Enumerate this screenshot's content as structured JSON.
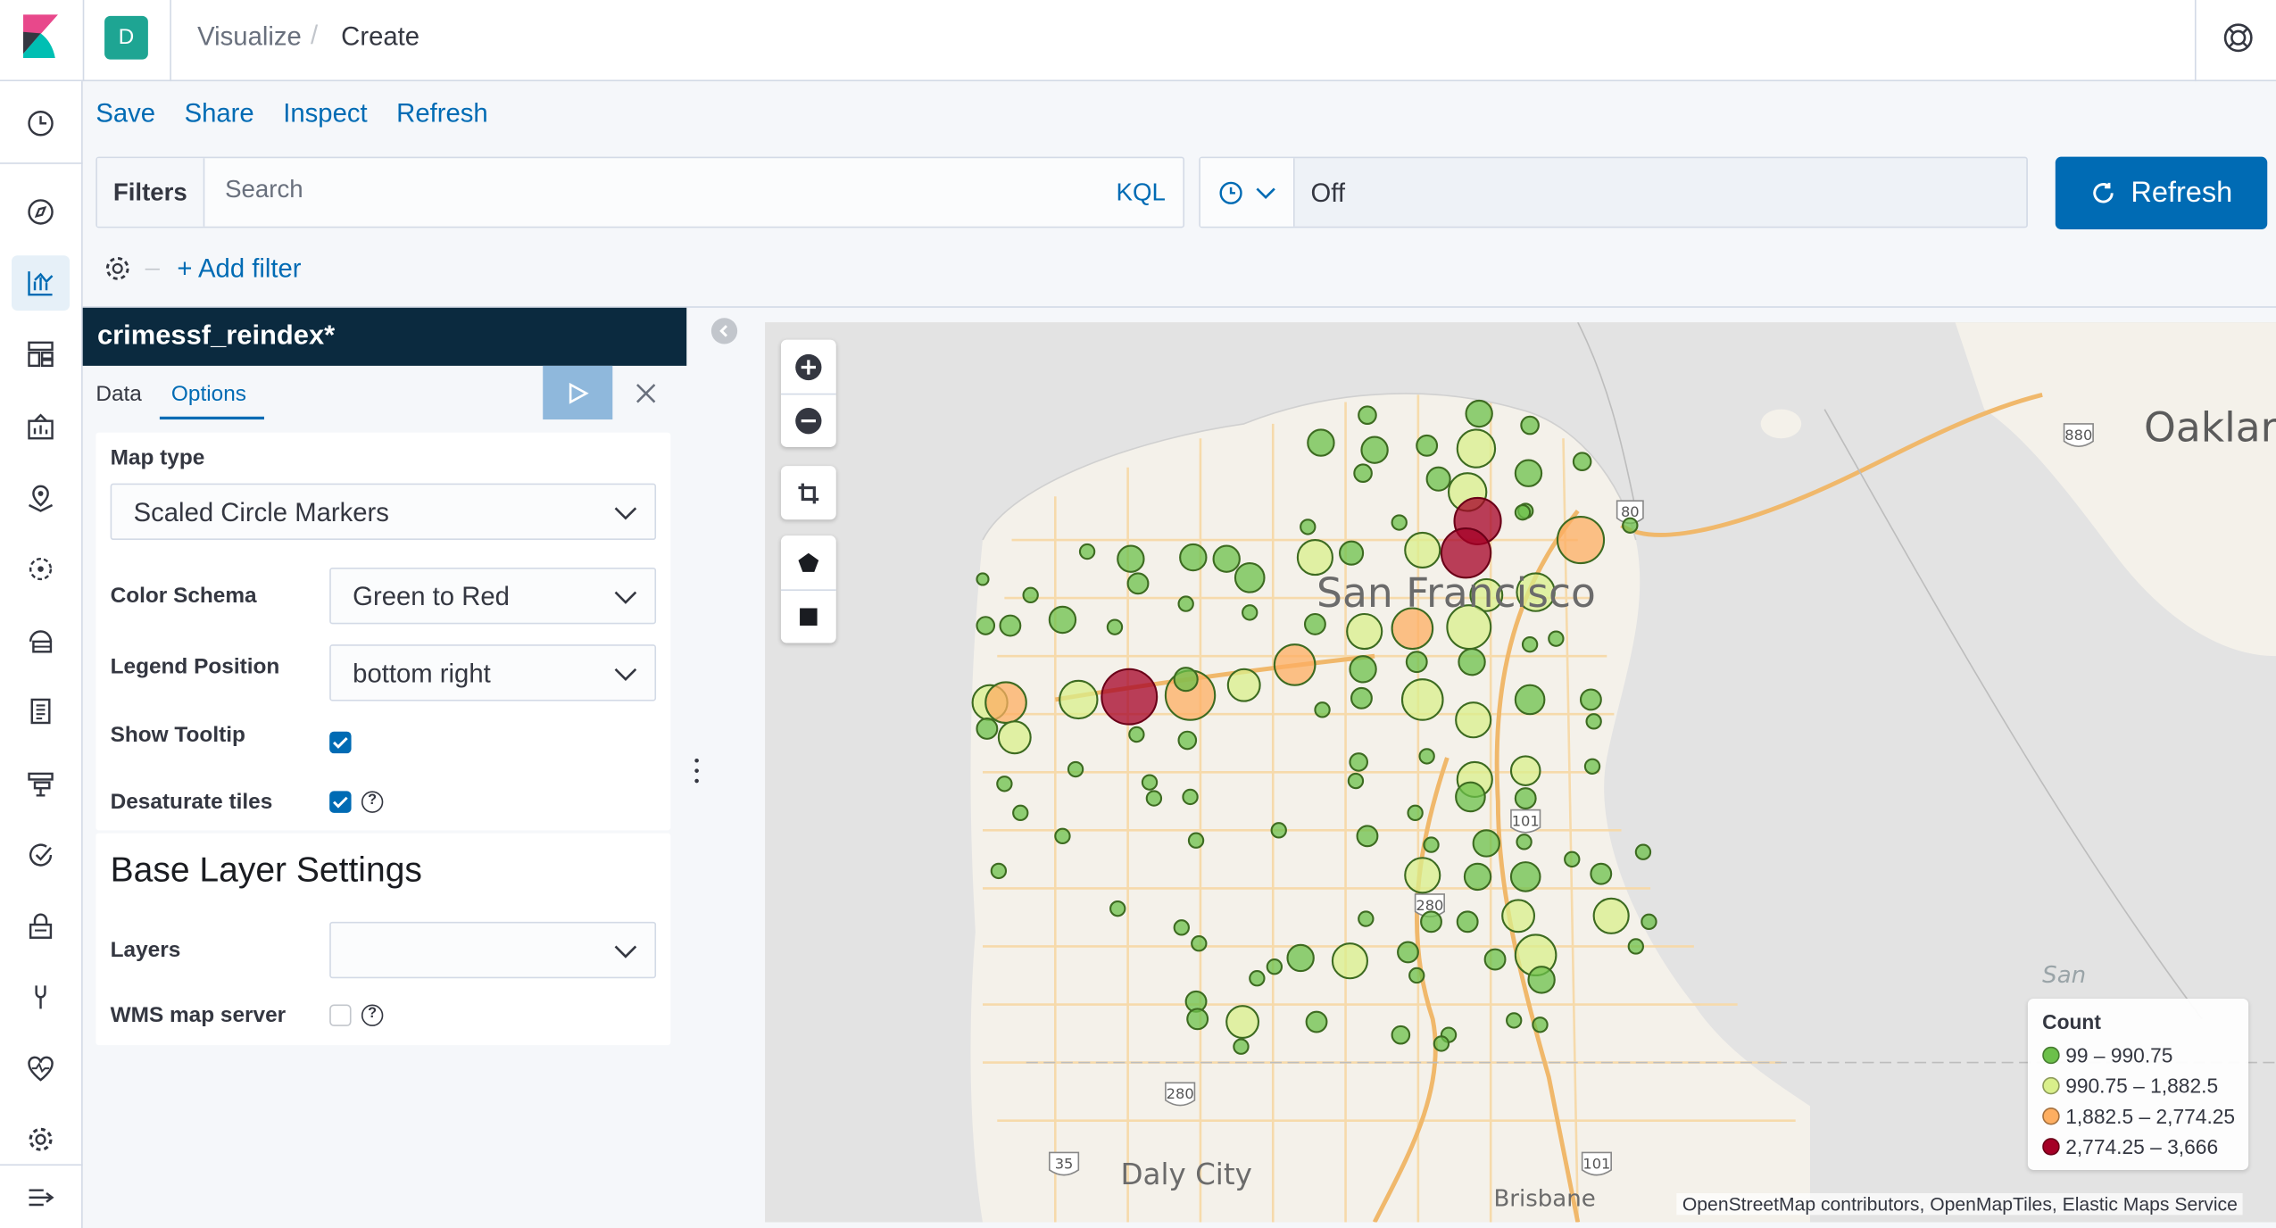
{
  "header": {
    "space_initial": "D",
    "breadcrumbs": [
      "Visualize",
      "Create"
    ],
    "breadcrumb_separator": "/"
  },
  "top_menu": [
    "Save",
    "Share",
    "Inspect",
    "Refresh"
  ],
  "query_bar": {
    "filters_label": "Filters",
    "search_placeholder": "Search",
    "language_label": "KQL",
    "refresh_interval_value": "Off",
    "refresh_button_label": "Refresh",
    "add_filter_label": "+ Add filter"
  },
  "editor": {
    "index_pattern": "crimessf_reindex*",
    "tabs": [
      "Data",
      "Options"
    ],
    "active_tab": "Options",
    "map_type_label": "Map type",
    "map_type_value": "Scaled Circle Markers",
    "color_schema_label": "Color Schema",
    "color_schema_value": "Green to Red",
    "legend_position_label": "Legend Position",
    "legend_position_value": "bottom right",
    "show_tooltip_label": "Show Tooltip",
    "show_tooltip_checked": true,
    "desaturate_label": "Desaturate tiles",
    "desaturate_checked": true,
    "base_layer_title": "Base Layer Settings",
    "layers_label": "Layers",
    "layers_value": "",
    "wms_label": "WMS map server",
    "wms_checked": false
  },
  "map": {
    "city_labels": {
      "san_francisco": "San Francisco",
      "oakland": "Oaklar",
      "daly_city": "Daly City",
      "brisbane": "Brisbane",
      "bay": "San"
    },
    "highway_shields": [
      "80",
      "880",
      "101",
      "280",
      "280",
      "35",
      "101"
    ],
    "legend": {
      "title": "Count",
      "ranges": [
        {
          "label": "99 – 990.75",
          "color": "#6cc04a"
        },
        {
          "label": "990.75 – 1,882.5",
          "color": "#d9ef8b"
        },
        {
          "label": "1,882.5 – 2,774.25",
          "color": "#fdae61"
        },
        {
          "label": "2,774.25 – 3,666",
          "color": "#a50026"
        }
      ]
    },
    "attribution": "OpenStreetMap contributors, OpenMapTiles, Elastic Maps Service"
  },
  "colors": {
    "accent": "#006bb4",
    "title_bar": "#0b2a3f",
    "space_avatar": "#1ea593"
  },
  "icons": {
    "nav": [
      "clock-icon",
      "compass-icon",
      "visualize-icon",
      "dashboard-icon",
      "canvas-icon",
      "maps-icon",
      "ml-icon",
      "infra-icon",
      "logs-icon",
      "apm-icon",
      "uptime-icon",
      "siem-icon",
      "devtools-icon",
      "monitoring-icon",
      "management-icon",
      "collapse-nav-icon"
    ]
  }
}
